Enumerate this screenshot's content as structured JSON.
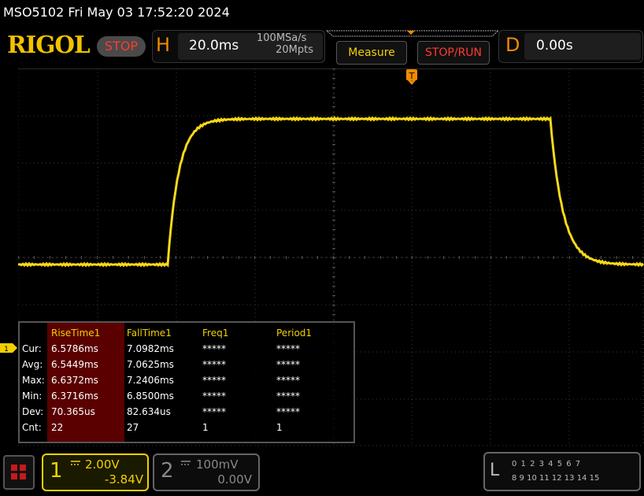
{
  "status": {
    "model": "MSO5102",
    "datetime": "Fri May 03 17:52:20 2024",
    "model_datetime": "MSO5102  Fri May 03 17:52:20 2024"
  },
  "brand": {
    "logo_text": "RIGOL",
    "run_state": "STOP"
  },
  "horizontal": {
    "letter": "H",
    "timebase": "20.0ms",
    "sample_rate": "100MSa/s",
    "memory_depth": "20Mpts"
  },
  "buttons": {
    "measure": "Measure",
    "stop_run": "STOP/RUN"
  },
  "delay": {
    "letter": "D",
    "value": "0.00s"
  },
  "trigger": {
    "marker_label": "T"
  },
  "channel_marker": {
    "label": "1"
  },
  "measurements": {
    "row_labels": [
      "Cur:",
      "Avg:",
      "Max:",
      "Min:",
      "Dev:",
      "Cnt:"
    ],
    "columns": [
      {
        "header": "RiseTime1",
        "values": [
          "6.5786ms",
          "6.5449ms",
          "6.6372ms",
          "6.3716ms",
          "70.365us",
          "22"
        ]
      },
      {
        "header": "FallTime1",
        "values": [
          "7.0982ms",
          "7.0625ms",
          "7.2406ms",
          "6.8500ms",
          "82.634us",
          "27"
        ]
      },
      {
        "header": "Freq1",
        "values": [
          "*****",
          "*****",
          "*****",
          "*****",
          "*****",
          "1"
        ]
      },
      {
        "header": "Period1",
        "values": [
          "*****",
          "*****",
          "*****",
          "*****",
          "*****",
          "1"
        ]
      }
    ]
  },
  "channels": {
    "ch1": {
      "number": "1",
      "scale": "2.00V",
      "offset": "-3.84V",
      "color": "#f2d000"
    },
    "ch2": {
      "number": "2",
      "scale": "100mV",
      "offset": "0.00V",
      "color": "#888888"
    }
  },
  "logic": {
    "letter": "L",
    "row1": "0 1 2 3  4 5 6 7",
    "row2": "8 9 10 11 12 13 14 15"
  },
  "colors": {
    "trace": "#f2d000",
    "grid": "#444444",
    "accent": "#f08a00",
    "stop": "#ff3b2f"
  }
}
